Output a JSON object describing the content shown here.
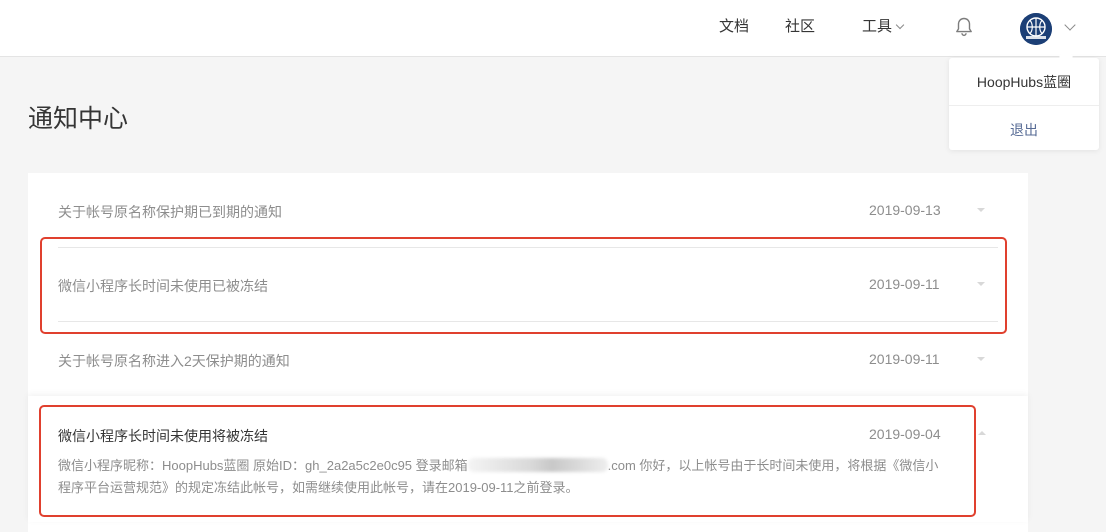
{
  "header": {
    "nav": {
      "docs": "文档",
      "community": "社区",
      "tools": "工具"
    }
  },
  "user_menu": {
    "account_name": "HoopHubs蓝圈",
    "logout": "退出"
  },
  "page": {
    "title": "通知中心"
  },
  "notifications": [
    {
      "title": "关于帐号原名称保护期已到期的通知",
      "date": "2019-09-13"
    },
    {
      "title": "微信小程序长时间未使用已被冻结",
      "date": "2019-09-11"
    },
    {
      "title": "关于帐号原名称进入2天保护期的通知",
      "date": "2019-09-11"
    }
  ],
  "expanded": {
    "title": "微信小程序长时间未使用将被冻结",
    "date": "2019-09-04",
    "body_part1": "微信小程序昵称：HoopHubs蓝圈 原始ID：gh_2a2a5c2e0c95 登录邮箱",
    "body_part2": ".com 你好，以上帐号由于长时间未使用，将根据《微信小程序平台运营规范》的规定冻结此帐号，如需继续使用此帐号，请在2019-09-11之前登录。"
  },
  "colors": {
    "highlight": "#e0402e",
    "link": "#576b95",
    "avatar": "#1c3f76"
  },
  "icons": {
    "bell": "bell-icon",
    "avatar": "basketball-avatar",
    "chevron": "chevron-down-icon"
  }
}
